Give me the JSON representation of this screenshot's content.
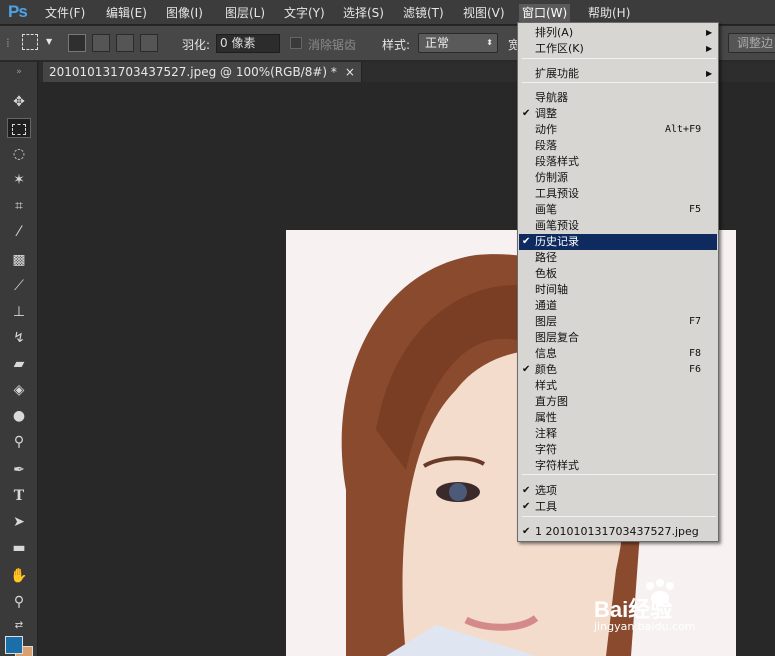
{
  "app": {
    "logo": "Ps"
  },
  "menubar": {
    "items": [
      "文件(F)",
      "编辑(E)",
      "图像(I)",
      "图层(L)",
      "文字(Y)",
      "选择(S)",
      "滤镜(T)",
      "视图(V)",
      "窗口(W)",
      "帮助(H)"
    ]
  },
  "options": {
    "feather_label": "羽化:",
    "feather_value": "0 像素",
    "antialias_label": "消除锯齿",
    "style_label": "样式:",
    "style_value": "正常",
    "width_label": "宽",
    "adjust_edge_label": "调整边"
  },
  "document": {
    "tab_title": "201010131703437527.jpeg @ 100%(RGB/8#) *",
    "close_glyph": "×"
  },
  "window_menu": {
    "items": [
      {
        "label": "排列(A)",
        "submenu": true
      },
      {
        "label": "工作区(K)",
        "submenu": true
      },
      {
        "label": "扩展功能",
        "submenu": true
      },
      {
        "label": "导航器"
      },
      {
        "label": "调整",
        "checked": true
      },
      {
        "label": "动作",
        "shortcut": "Alt+F9"
      },
      {
        "label": "段落"
      },
      {
        "label": "段落样式"
      },
      {
        "label": "仿制源"
      },
      {
        "label": "工具预设"
      },
      {
        "label": "画笔",
        "shortcut": "F5"
      },
      {
        "label": "画笔预设"
      },
      {
        "label": "历史记录",
        "checked": true,
        "highlighted": true
      },
      {
        "label": "路径"
      },
      {
        "label": "色板"
      },
      {
        "label": "时间轴"
      },
      {
        "label": "通道"
      },
      {
        "label": "图层",
        "shortcut": "F7"
      },
      {
        "label": "图层复合"
      },
      {
        "label": "信息",
        "shortcut": "F8"
      },
      {
        "label": "颜色",
        "shortcut": "F6",
        "checked": true
      },
      {
        "label": "样式"
      },
      {
        "label": "直方图"
      },
      {
        "label": "属性"
      },
      {
        "label": "注释"
      },
      {
        "label": "字符"
      },
      {
        "label": "字符样式"
      },
      {
        "label": "选项",
        "checked": true
      },
      {
        "label": "工具",
        "checked": true
      },
      {
        "label": "1 201010131703437527.jpeg",
        "checked": true
      }
    ]
  },
  "watermark": {
    "text": "Bai经验",
    "url": "jingyan.baidu.com"
  },
  "colors": {
    "menu_highlight": "#0f2a5e",
    "menu_bg": "#d8d6d3",
    "ps_blue": "#4aa3e8",
    "foreground": "#1b6fa8",
    "background": "#d8a070"
  }
}
